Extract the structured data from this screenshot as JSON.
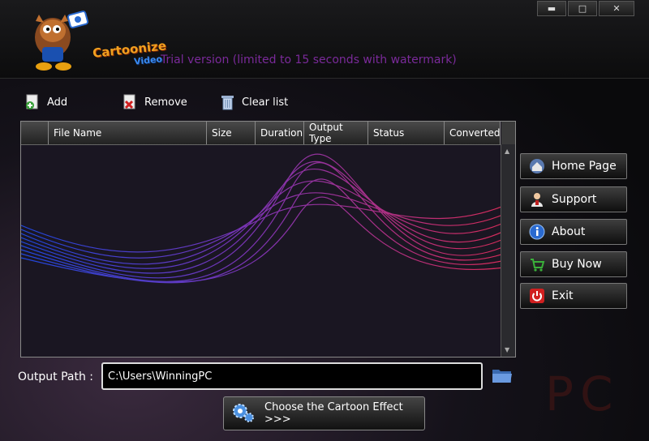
{
  "app": {
    "logo_text": "Cartoonize",
    "logo_sub": "Video",
    "trial_notice": "Trial version (limited to 15 seconds with watermark)"
  },
  "window_controls": {
    "minimize": "▬",
    "maximize": "□",
    "close": "✕"
  },
  "toolbar": {
    "add": "Add",
    "remove": "Remove",
    "clear": "Clear list"
  },
  "file_table": {
    "columns": [
      "",
      "File Name",
      "Size",
      "Duration",
      "Output Type",
      "Status",
      "Converted"
    ],
    "rows": []
  },
  "sidebar": {
    "items": [
      {
        "label": "Home Page",
        "icon": "home-icon"
      },
      {
        "label": "Support",
        "icon": "support-person-icon"
      },
      {
        "label": "About",
        "icon": "info-icon"
      },
      {
        "label": "Buy Now",
        "icon": "cart-icon"
      },
      {
        "label": "Exit",
        "icon": "power-icon"
      }
    ]
  },
  "output": {
    "label": "Output Path :",
    "value": "C:\\Users\\WinningPC"
  },
  "choose_effect": {
    "label": "Choose the Cartoon Effect >>>"
  },
  "watermark": "PC",
  "colors": {
    "trial_text": "#7a2a9a",
    "accent_orange": "#f0a020",
    "accent_blue": "#3a8af0"
  }
}
